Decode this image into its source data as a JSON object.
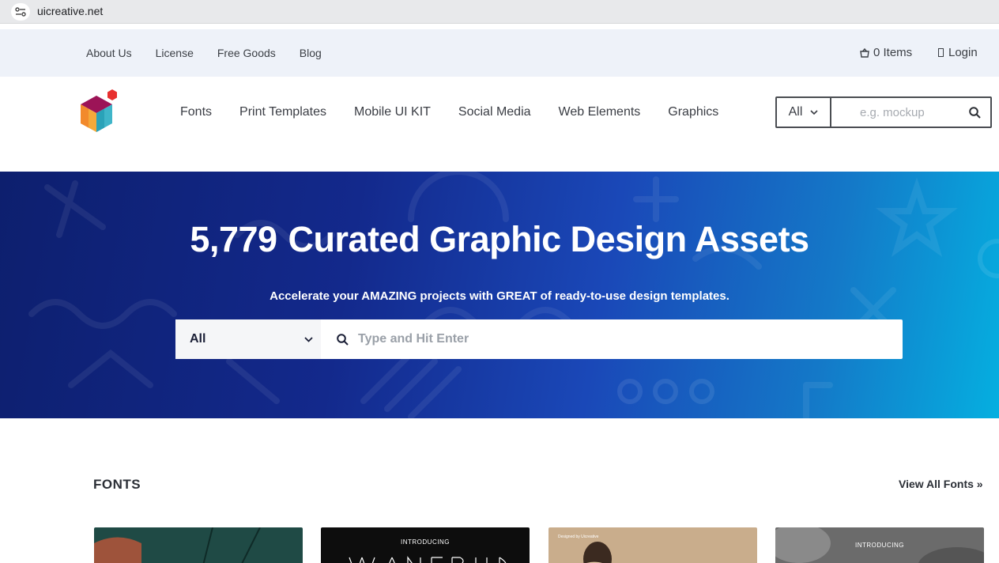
{
  "browser": {
    "url": "uicreative.net"
  },
  "util_bar": {
    "links": [
      "About Us",
      "License",
      "Free Goods",
      "Blog"
    ],
    "cart": "0 Items",
    "login": "Login"
  },
  "nav": {
    "links": [
      "Fonts",
      "Print Templates",
      "Mobile UI KIT",
      "Social Media",
      "Web Elements",
      "Graphics"
    ],
    "search_select": "All",
    "search_placeholder": "e.g. mockup"
  },
  "hero": {
    "count": "5,779",
    "title": "Curated Graphic Design Assets",
    "subtitle": "Accelerate your AMAZING projects with GREAT of ready-to-use design templates.",
    "search_select": "All",
    "search_placeholder": "Type and Hit Enter"
  },
  "fonts_section": {
    "title": "FONTS",
    "view_all": "View All Fonts »",
    "cards": [
      {
        "label": "",
        "bg": "#1f4a45"
      },
      {
        "label": "INTRODUCING",
        "bg": "#0d0d0d"
      },
      {
        "label": "Designed by Uicreative",
        "bg": "#c9ad8c"
      },
      {
        "label": "INTRODUCING",
        "bg": "#6b6b6b"
      }
    ]
  },
  "colors": {
    "hero_start": "#0d1f6e",
    "hero_end": "#05afe0",
    "util_bar_bg": "#eef2f9"
  }
}
